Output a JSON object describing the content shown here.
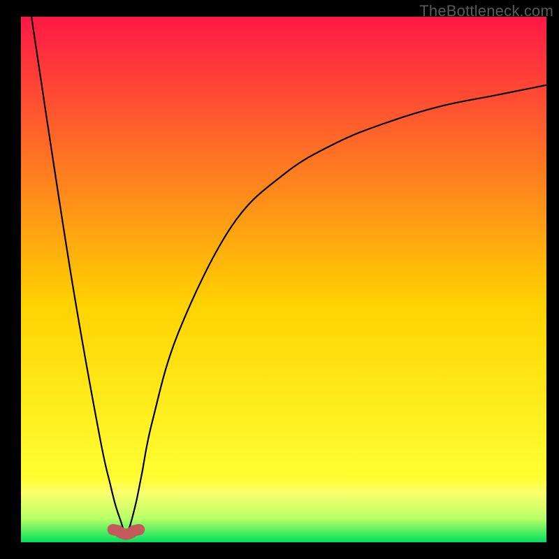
{
  "watermark": "TheBottleneck.com",
  "chart_data": {
    "type": "line",
    "title": "",
    "xlabel": "",
    "ylabel": "",
    "xlim": [
      0,
      100
    ],
    "ylim": [
      0,
      100
    ],
    "grid": false,
    "legend": false,
    "series": [
      {
        "name": "bottleneck-curve",
        "x": [
          2,
          5,
          10,
          15,
          17,
          18,
          19,
          19.5,
          20,
          20.5,
          21,
          22,
          23,
          25,
          30,
          40,
          50,
          60,
          70,
          80,
          90,
          95,
          100
        ],
        "values": [
          100,
          80,
          48,
          20,
          11,
          7,
          4,
          2.5,
          2,
          2.5,
          4,
          8,
          13,
          23,
          40,
          60,
          70,
          76,
          80,
          83,
          85,
          86,
          87
        ]
      },
      {
        "name": "marker",
        "x": [
          17.5,
          18.5,
          19,
          19.5,
          20,
          20.5,
          21,
          21.5,
          22.5
        ],
        "values": [
          2.4,
          2.2,
          1.8,
          1.6,
          1.5,
          1.6,
          1.8,
          2.2,
          2.4
        ]
      }
    ],
    "background_gradient": {
      "top_color": "#ff1846",
      "mid_color": "#ffd300",
      "band_color": "#fcff6e",
      "bottom_color": "#00e060"
    },
    "marker_color": "#c55a5a",
    "curve_color": "#000000"
  }
}
